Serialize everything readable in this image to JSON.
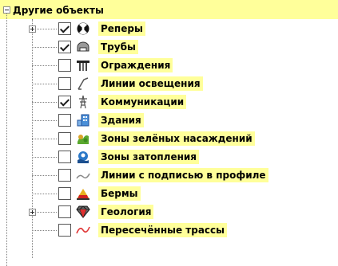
{
  "tree": {
    "root": {
      "label": "Другие объекты",
      "expanded": true
    },
    "items": [
      {
        "label": "Реперы",
        "checked": true,
        "expander": "plus",
        "icon": "benchmark-icon"
      },
      {
        "label": "Трубы",
        "checked": true,
        "expander": null,
        "icon": "pipe-icon"
      },
      {
        "label": "Ограждения",
        "checked": false,
        "expander": null,
        "icon": "fence-icon"
      },
      {
        "label": "Линии освещения",
        "checked": false,
        "expander": null,
        "icon": "lighting-line-icon"
      },
      {
        "label": "Коммуникации",
        "checked": true,
        "expander": null,
        "icon": "power-tower-icon"
      },
      {
        "label": "Здания",
        "checked": false,
        "expander": null,
        "icon": "building-icon"
      },
      {
        "label": "Зоны зелёных насаждений",
        "checked": false,
        "expander": null,
        "icon": "green-zone-icon"
      },
      {
        "label": "Зоны затопления",
        "checked": false,
        "expander": null,
        "icon": "flood-zone-icon"
      },
      {
        "label": "Линии с подписью в профиле",
        "checked": false,
        "expander": null,
        "icon": "profile-line-icon"
      },
      {
        "label": "Бермы",
        "checked": false,
        "expander": null,
        "icon": "berm-icon"
      },
      {
        "label": "Геология",
        "checked": false,
        "expander": "plus",
        "icon": "geology-icon"
      },
      {
        "label": "Пересечённые трассы",
        "checked": false,
        "expander": null,
        "icon": "crossed-route-icon"
      }
    ]
  },
  "colors": {
    "highlight": "#ffff9a",
    "tree_lines": "#808080"
  }
}
